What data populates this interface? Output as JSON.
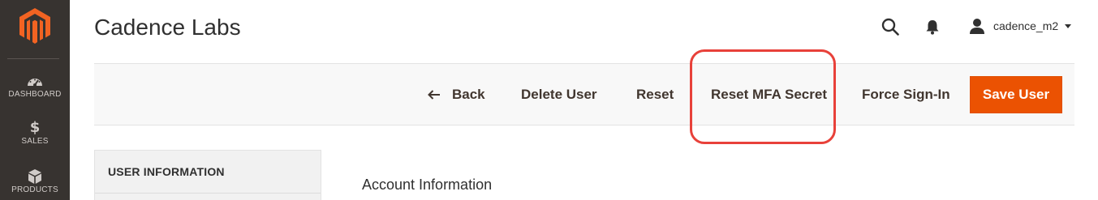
{
  "admin_menu": {
    "logo": "magento-logo",
    "items": [
      {
        "label": "DASHBOARD",
        "icon": "dashboard-gauge-icon"
      },
      {
        "label": "SALES",
        "icon": "dollar-icon"
      },
      {
        "label": "PRODUCTS",
        "icon": "cube-icon"
      }
    ]
  },
  "header": {
    "title": "Cadence Labs",
    "search_icon": "search-icon",
    "notifications_icon": "bell-icon",
    "user": {
      "name": "cadence_m2",
      "icon": "user-icon"
    }
  },
  "actions": {
    "back": "Back",
    "delete_user": "Delete User",
    "reset": "Reset",
    "reset_mfa": "Reset MFA Secret",
    "force_sign_in": "Force Sign-In",
    "save_user": "Save User"
  },
  "tabs": {
    "title": "USER INFORMATION"
  },
  "main": {
    "section_title": "Account Information"
  },
  "colors": {
    "menu_bg": "#373330",
    "accent": "#eb5202",
    "highlight": "#e8413a",
    "action_bar_bg": "#f8f8f8"
  }
}
